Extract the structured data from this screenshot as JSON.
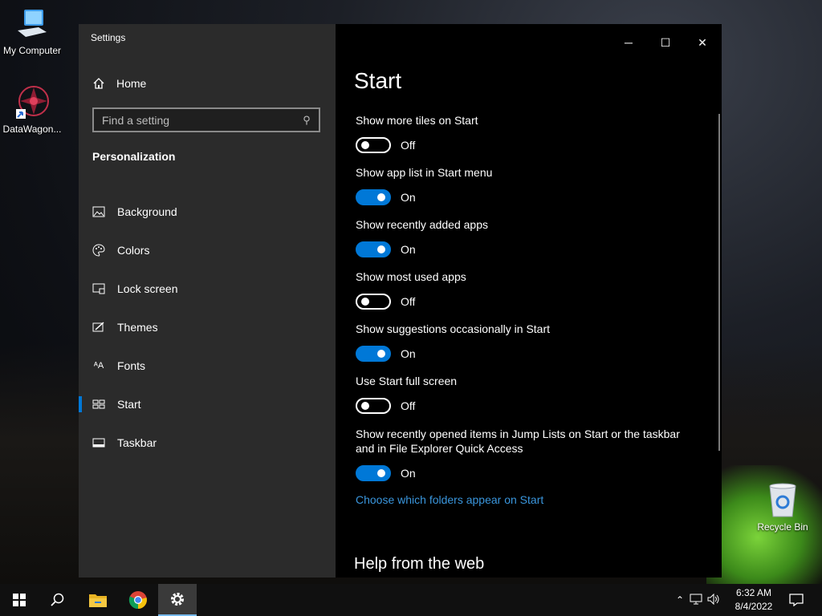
{
  "desktop": {
    "icons": [
      {
        "label": "My Computer"
      },
      {
        "label": "DataWagon..."
      },
      {
        "label": "Recycle Bin"
      }
    ]
  },
  "window": {
    "title": "Settings",
    "controls": {
      "minimize": "─",
      "maximize": "☐",
      "close": "✕"
    }
  },
  "sidebar": {
    "home_label": "Home",
    "search_placeholder": "Find a setting",
    "section_title": "Personalization",
    "items": [
      {
        "label": "Background",
        "icon": "picture-icon"
      },
      {
        "label": "Colors",
        "icon": "palette-icon"
      },
      {
        "label": "Lock screen",
        "icon": "lock-screen-icon"
      },
      {
        "label": "Themes",
        "icon": "themes-icon"
      },
      {
        "label": "Fonts",
        "icon": "fonts-icon"
      },
      {
        "label": "Start",
        "icon": "start-icon",
        "active": true
      },
      {
        "label": "Taskbar",
        "icon": "taskbar-icon"
      }
    ]
  },
  "main": {
    "title": "Start",
    "settings": [
      {
        "label": "Show more tiles on Start",
        "state": "Off"
      },
      {
        "label": "Show app list in Start menu",
        "state": "On"
      },
      {
        "label": "Show recently added apps",
        "state": "On"
      },
      {
        "label": "Show most used apps",
        "state": "Off"
      },
      {
        "label": "Show suggestions occasionally in Start",
        "state": "On"
      },
      {
        "label": "Use Start full screen",
        "state": "Off"
      },
      {
        "label": "Show recently opened items in Jump Lists on Start or the taskbar and in File Explorer Quick Access",
        "state": "On"
      }
    ],
    "link": "Choose which folders appear on Start",
    "help_heading": "Help from the web"
  },
  "taskbar": {
    "apps": [
      "start-icon",
      "search-icon",
      "file-explorer-icon",
      "chrome-icon",
      "settings-icon"
    ],
    "clock": {
      "time": "6:32 AM",
      "date": "8/4/2022"
    }
  },
  "colors": {
    "accent": "#0078d7",
    "link": "#3a96dd",
    "sidebar": "#2b2b2b"
  }
}
